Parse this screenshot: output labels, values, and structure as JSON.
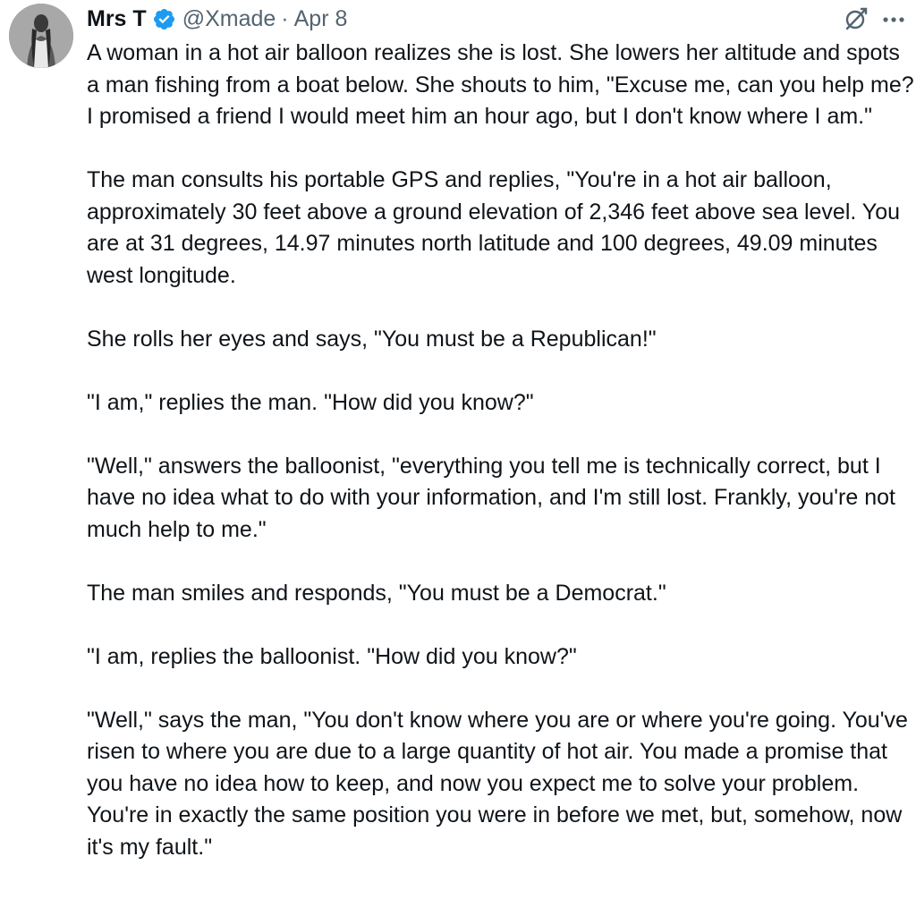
{
  "author": {
    "display_name": "Mrs T",
    "handle": "@Xmade",
    "separator": "·",
    "date": "Apr 8",
    "verified_color": "#1d9bf0"
  },
  "icons": {
    "verified": "verified-badge-icon",
    "grok": "grok-icon",
    "more": "more-horizontal-icon"
  },
  "tweet": {
    "paragraphs": [
      "A woman in a hot air balloon realizes she is lost. She lowers her altitude and spots a man fishing from a boat below. She shouts to him, \"Excuse me, can you help me? I promised a friend I would meet him an hour ago, but I don't know where I am.\"",
      "The man consults his portable GPS and replies, \"You're in a hot air balloon, approximately 30 feet above a ground elevation of 2,346 feet above sea level. You are at 31 degrees, 14.97 minutes north latitude and 100 degrees, 49.09 minutes west longitude.",
      "She rolls her eyes and says, \"You must be a Republican!\"",
      "\"I am,\" replies the man. \"How did you know?\"",
      "\"Well,\" answers the balloonist, \"everything you tell me is technically correct, but I have no idea what to do with your information, and I'm still lost. Frankly, you're not much help to me.\"",
      "The man smiles and responds, \"You must be a Democrat.\"",
      "\"I am, replies the balloonist. \"How did you know?\"",
      "\"Well,\" says the man, \"You don't know where you are or where you're going. You've risen to where you are due to a large quantity of hot air. You made a promise that you have no idea how to keep, and now you expect me to solve your problem. You're in exactly the same position you were in before we met, but, somehow, now it's my fault.\""
    ]
  }
}
